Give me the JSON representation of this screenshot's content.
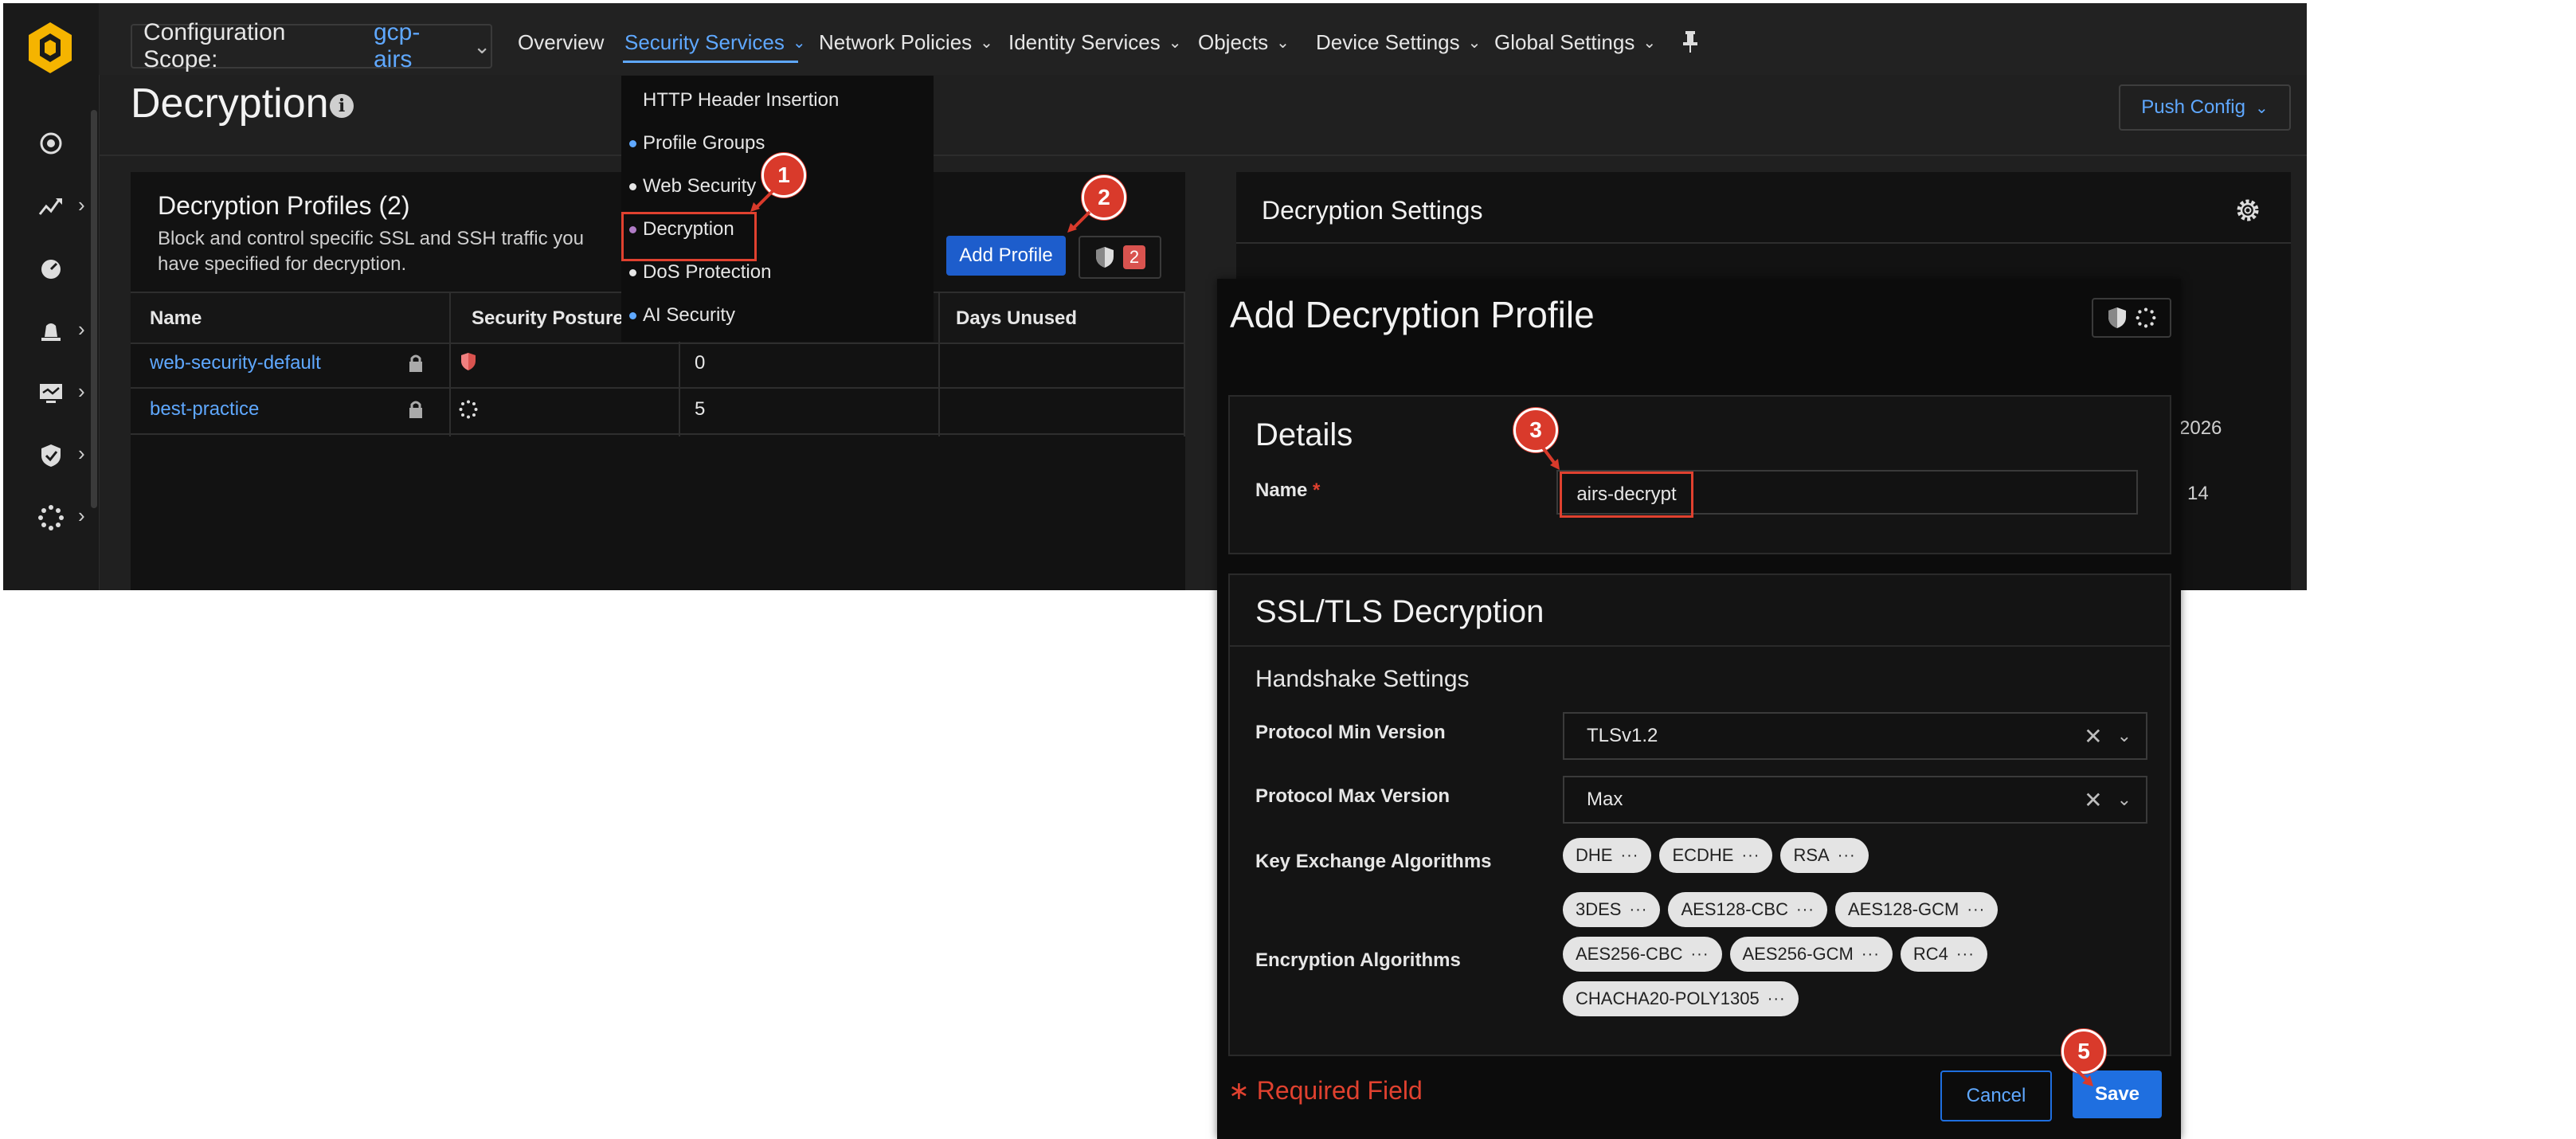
{
  "app": {
    "scope_label": "Configuration Scope:",
    "scope_value": "gcp-airs",
    "nav": [
      {
        "label": "Overview"
      },
      {
        "label": "Security Services"
      },
      {
        "label": "Network Policies"
      },
      {
        "label": "Identity Services"
      },
      {
        "label": "Objects"
      },
      {
        "label": "Device Settings"
      },
      {
        "label": "Global Settings"
      }
    ],
    "page_title": "Decryption",
    "push_config": "Push Config"
  },
  "dropdown": {
    "items": [
      {
        "label": "HTTP Header Insertion"
      },
      {
        "label": "Profile Groups"
      },
      {
        "label": "Web Security"
      },
      {
        "label": "Decryption"
      },
      {
        "label": "DoS Protection"
      },
      {
        "label": "AI Security"
      }
    ]
  },
  "profiles": {
    "title": "Decryption Profiles (2)",
    "description": "Block and control specific SSL and SSH traffic you have specified for decryption.",
    "add_button": "Add Profile",
    "badge_count": "2",
    "columns": [
      "Name",
      "Security Posture",
      "Days Unused"
    ],
    "rows": [
      {
        "name": "web-security-default",
        "value": "0"
      },
      {
        "name": "best-practice",
        "value": "5"
      }
    ]
  },
  "settings": {
    "title": "Decryption Settings",
    "peek1": "2026",
    "peek2": "14"
  },
  "modal": {
    "title": "Add Decryption Profile",
    "details": {
      "header": "Details",
      "name_label": "Name",
      "name_value": "airs-decrypt",
      "required_mark": "*"
    },
    "ssl": {
      "header": "SSL/TLS Decryption",
      "subheader": "Handshake Settings",
      "min_label": "Protocol Min Version",
      "min_value": "TLSv1.2",
      "max_label": "Protocol Max Version",
      "max_value": "Max",
      "kex_label": "Key Exchange Algorithms",
      "kex": [
        "DHE",
        "ECDHE",
        "RSA"
      ],
      "enc_label": "Encryption Algorithms",
      "enc": [
        "3DES",
        "AES128-CBC",
        "AES128-GCM",
        "AES256-CBC",
        "AES256-GCM",
        "RC4",
        "CHACHA20-POLY1305"
      ]
    },
    "required_field": "∗ Required Field",
    "cancel": "Cancel",
    "save": "Save"
  },
  "callouts": [
    "1",
    "2",
    "3",
    "5"
  ],
  "colors": {
    "accent": "#5fa8ff",
    "primary_button": "#1f6fe0",
    "callout": "#d93a2b",
    "highlight": "#e0412f"
  }
}
